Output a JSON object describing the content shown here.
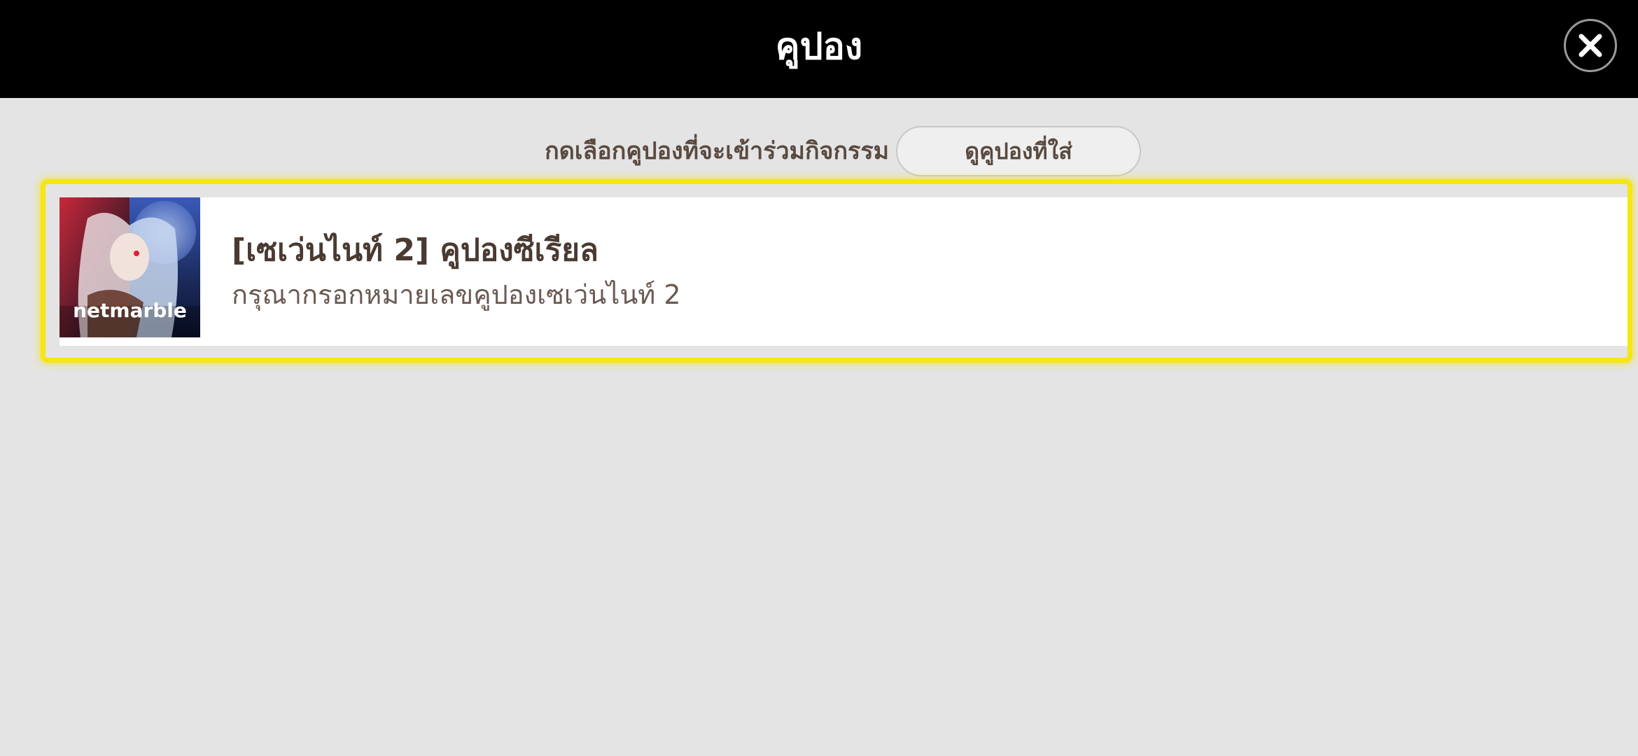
{
  "header": {
    "title": "คูปอง",
    "close_icon": "close-icon"
  },
  "instruction": {
    "text": "กดเลือกคูปองที่จะเข้าร่วมกิจกรรม",
    "view_used_button": "ดูคูปองที่ใส่"
  },
  "coupon": {
    "title": "[เซเว่นไนท์ 2] คูปองซีเรียล",
    "description": "กรุณากรอกหมายเลขคูปองเซเว่นไนท์ 2",
    "thumbnail_logo_text": "netmarble"
  },
  "colors": {
    "header_bg": "#000000",
    "page_bg": "#e4e4e4",
    "highlight": "#f5e614",
    "text_brown": "#4a3a32"
  }
}
